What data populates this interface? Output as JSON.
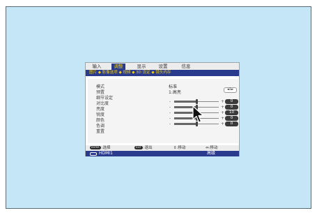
{
  "tabs": [
    "输入",
    "调整",
    "显示",
    "设置",
    "信息"
  ],
  "active_tab_index": 1,
  "breadcrumb": "图片 ◆ 影像选项 ◆ 视频 ◆ 3D 设定 ◆ 镜头内存",
  "labels": [
    "模式",
    "预置",
    "细节设定",
    "对比度",
    "亮度",
    "锐度",
    "颜色",
    "色调",
    "重置"
  ],
  "mode_value": "标准",
  "preset_value": "1:高亮",
  "preset_arrows": "◄1►",
  "sliders": [
    {
      "level": 0.5,
      "value": "0"
    },
    {
      "level": 0.5,
      "value": "0"
    },
    {
      "level": 0.5,
      "value": "10"
    },
    {
      "level": 0.5,
      "value": "0"
    },
    {
      "level": 0.5,
      "value": "0"
    }
  ],
  "slider_minus": "-",
  "slider_plus": "+",
  "footer": {
    "enter_key": "ENTER",
    "enter_label": ":选择",
    "exit_key": "EXIT",
    "exit_label": ":退出",
    "move_label": "⇕:移动",
    "adjust_label": "⇔:移动"
  },
  "source": {
    "label": "HDMI1",
    "mode": "高级"
  },
  "colors": {
    "screen_bg": "#c5e6f6",
    "menu_accent": "#2a3a8c",
    "active_text": "#f5d000"
  }
}
